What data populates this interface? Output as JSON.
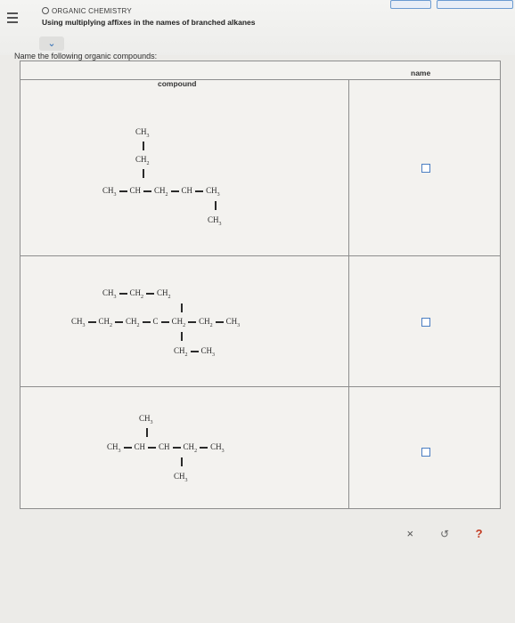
{
  "header": {
    "topic": "ORGANIC CHEMISTRY",
    "subtitle": "Using multiplying affixes in the names of branched alkanes",
    "expand_glyph": "⌄"
  },
  "prompt": "Name the following organic compounds:",
  "table": {
    "col_compound": "compound",
    "col_name": "name",
    "rows": [
      {
        "answer": "",
        "m1": {
          "top1": "CH",
          "top1sub": "3",
          "top2": "CH",
          "top2sub": "2",
          "c1": "CH",
          "c1sub": "3",
          "c2": "CH",
          "c3": "CH",
          "c3sub": "2",
          "c4": "CH",
          "c5": "CH",
          "c5sub": "3",
          "bot": "CH",
          "botsub": "3"
        }
      },
      {
        "answer": "",
        "m2": {
          "top_a": "CH",
          "top_asub": "3",
          "top_b": "CH",
          "top_bsub": "2",
          "top_c": "CH",
          "top_csub": "2",
          "c1": "CH",
          "c1sub": "3",
          "c2": "CH",
          "c2sub": "2",
          "c3": "CH",
          "c3sub": "2",
          "c4": "C",
          "c5": "CH",
          "c5sub": "2",
          "c6": "CH",
          "c6sub": "2",
          "c7": "CH",
          "c7sub": "3",
          "bot_a": "CH",
          "bot_asub": "2",
          "bot_b": "CH",
          "bot_bsub": "3"
        }
      },
      {
        "answer": "",
        "m3": {
          "top": "CH",
          "topsub": "3",
          "c1": "CH",
          "c1sub": "3",
          "c2": "CH",
          "c3": "CH",
          "c4": "CH",
          "c4sub": "2",
          "c5": "CH",
          "c5sub": "3",
          "bot": "CH",
          "botsub": "3"
        }
      }
    ]
  },
  "controls": {
    "clear": "×",
    "undo": "↺",
    "help": "?"
  },
  "colors": {
    "accent": "#2d6db5",
    "help": "#c23b22",
    "border": "#8d8d8d"
  }
}
